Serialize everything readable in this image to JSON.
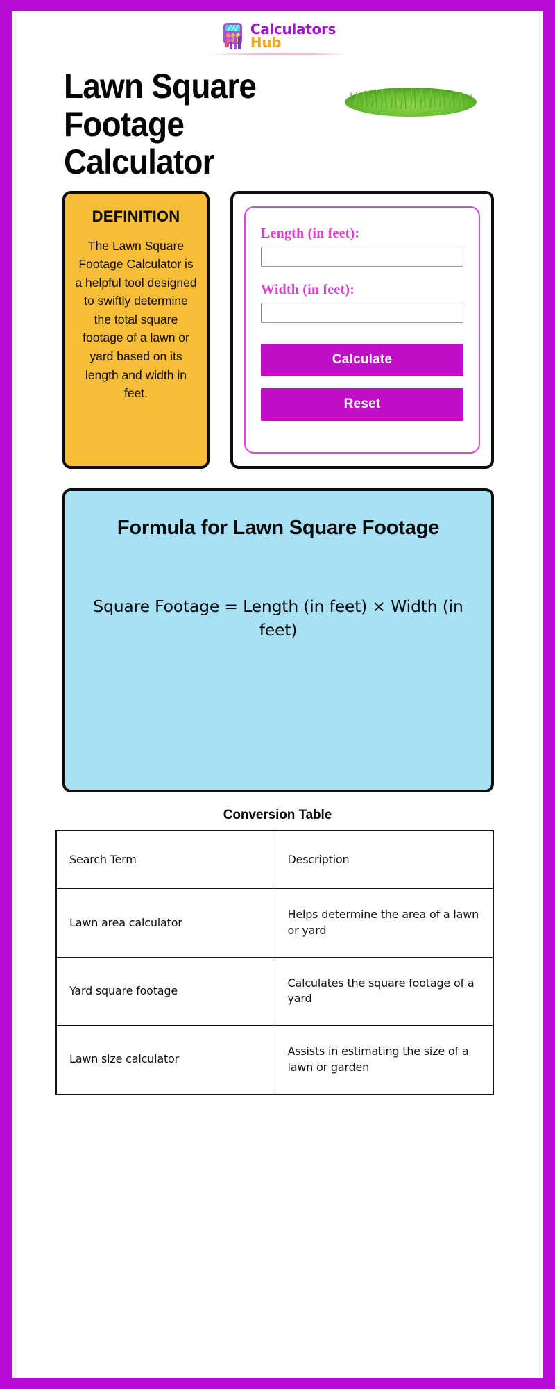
{
  "brand": {
    "line1": "Calculators",
    "line2": "Hub",
    "logo_icon": "calculator-bars-logo-icon",
    "purple": "#9c1ac7",
    "gold": "#f0a81e"
  },
  "frame": {
    "border_color": "#b80bd6"
  },
  "header": {
    "title": "Lawn Square Footage Calculator",
    "decoration_icon": "grass-patch-image"
  },
  "definition": {
    "heading": "DEFINITION",
    "text": "The Lawn Square Footage Calculator is a helpful tool designed to swiftly determine the total square footage of a lawn or yard based on its length and width in feet.",
    "background": "#f8bd36"
  },
  "calculator": {
    "fields": [
      {
        "label": "Length (in feet):",
        "value": "",
        "placeholder": ""
      },
      {
        "label": "Width (in feet):",
        "value": "",
        "placeholder": ""
      }
    ],
    "calculate_label": "Calculate",
    "reset_label": "Reset",
    "button_color": "#c10fc8",
    "label_color": "#d93fd0"
  },
  "formula": {
    "heading": "Formula for Lawn Square Footage",
    "expression": "Square Footage = Length (in feet) × Width (in feet)",
    "background": "#a8e1f5"
  },
  "conversion_table": {
    "heading": "Conversion Table",
    "columns": [
      "Search Term",
      "Description"
    ],
    "rows": [
      {
        "term": "Lawn area calculator",
        "description": "Helps determine the area of a lawn or yard"
      },
      {
        "term": "Yard square footage",
        "description": "Calculates the square footage of a yard"
      },
      {
        "term": "Lawn size calculator",
        "description": "Assists in estimating the size of a lawn or garden"
      }
    ]
  }
}
